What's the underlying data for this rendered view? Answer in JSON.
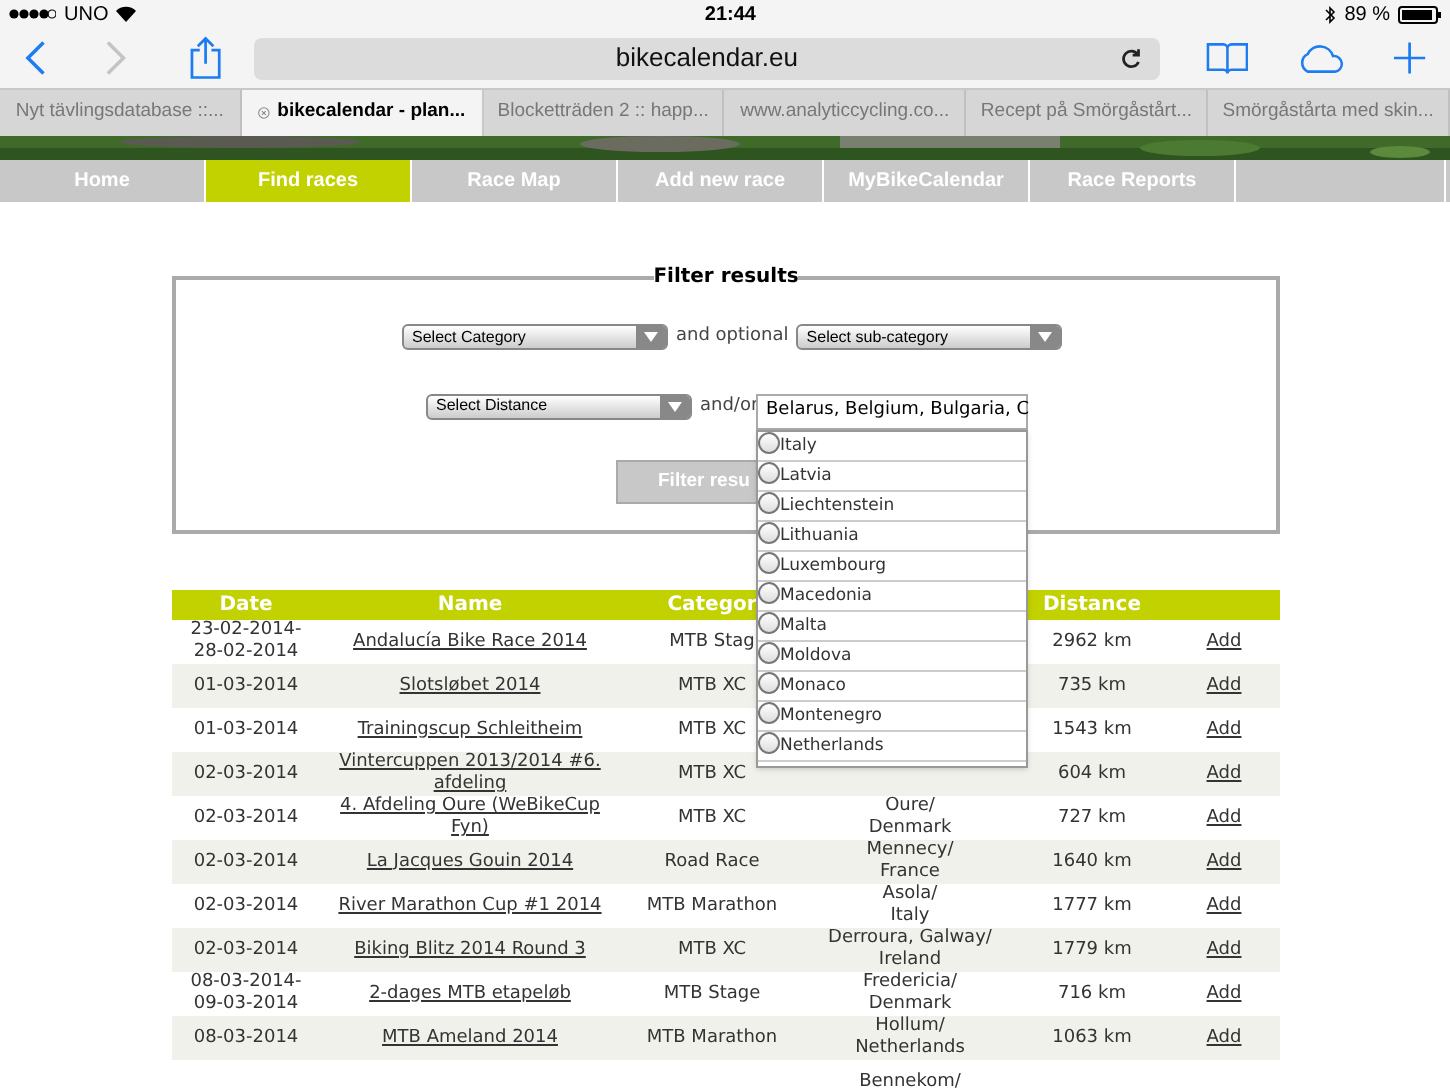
{
  "status_bar": {
    "carrier": "UNO",
    "time": "21:44",
    "battery": "89 %"
  },
  "browser": {
    "url": "bikecalendar.eu",
    "tabs": [
      {
        "label": "Nyt tävlingsdatabase ::...",
        "selected": false
      },
      {
        "label": "bikecalendar - plan...",
        "selected": true
      },
      {
        "label": "Blocketträden 2 :: happ...",
        "selected": false
      },
      {
        "label": "www.analyticcycling.co...",
        "selected": false
      },
      {
        "label": "Recept på Smörgåstårt...",
        "selected": false
      },
      {
        "label": "Smörgåstårta med skin...",
        "selected": false
      }
    ]
  },
  "nav": [
    {
      "label": "Home",
      "selected": false
    },
    {
      "label": "Find races",
      "selected": true
    },
    {
      "label": "Race Map",
      "selected": false
    },
    {
      "label": "Add new race",
      "selected": false
    },
    {
      "label": "MyBikeCalendar",
      "selected": false
    },
    {
      "label": "Race Reports",
      "selected": false
    }
  ],
  "filter": {
    "title": "Filter results",
    "category": "Select Category",
    "and_optional": "and optional",
    "subcategory": "Select sub-category",
    "distance": "Select Distance",
    "and_or": "and/or",
    "countries": "Belarus, Belgium, Bulgaria, C",
    "button": "Filter resu",
    "options": [
      {
        "label": "Italy",
        "checked": false
      },
      {
        "label": "Latvia",
        "checked": false
      },
      {
        "label": "Liechtenstein",
        "checked": false
      },
      {
        "label": "Lithuania",
        "checked": false
      },
      {
        "label": "Luxembourg",
        "checked": false
      },
      {
        "label": "Macedonia",
        "checked": false
      },
      {
        "label": "Malta",
        "checked": false
      },
      {
        "label": "Moldova",
        "checked": false
      },
      {
        "label": "Monaco",
        "checked": false
      },
      {
        "label": "Montenegro",
        "checked": false
      },
      {
        "label": "Netherlands",
        "checked": false
      }
    ]
  },
  "table": {
    "columns": {
      "date": "Date",
      "name": "Name",
      "category": "Categor",
      "distance": "Distance"
    },
    "rows": [
      {
        "date": "23-02-2014-\n28-02-2014",
        "name": "Andalucía Bike Race 2014",
        "category": "MTB Stag",
        "distance": "2962 km",
        "action": "Add"
      },
      {
        "date": "01-03-2014",
        "name": "Slotsløbet 2014",
        "category": "MTB XC",
        "distance": "735 km",
        "action": "Add"
      },
      {
        "date": "01-03-2014",
        "name": "Trainingscup Schleitheim",
        "category": "MTB XC",
        "distance": "1543 km",
        "action": "Add"
      },
      {
        "date": "02-03-2014",
        "name": "Vintercuppen 2013/2014 #6. afdeling",
        "category": "MTB XC",
        "distance": "604 km",
        "action": "Add"
      },
      {
        "date": "02-03-2014",
        "name": "4. Afdeling Oure (WeBikeCup Fyn)",
        "category": "MTB XC",
        "location": "Oure/\nDenmark",
        "distance": "727 km",
        "action": "Add"
      },
      {
        "date": "02-03-2014",
        "name": "La Jacques Gouin 2014",
        "category": "Road Race",
        "location": "Mennecy/\nFrance",
        "distance": "1640 km",
        "action": "Add"
      },
      {
        "date": "02-03-2014",
        "name": "River Marathon Cup #1 2014",
        "category": "MTB Marathon",
        "location": "Asola/\nItaly",
        "distance": "1777 km",
        "action": "Add"
      },
      {
        "date": "02-03-2014",
        "name": "Biking Blitz 2014 Round 3",
        "category": "MTB XC",
        "location": "Derroura, Galway/\nIreland",
        "distance": "1779 km",
        "action": "Add"
      },
      {
        "date": "08-03-2014-\n09-03-2014",
        "name": "2-dages MTB etapeløb",
        "category": "MTB Stage",
        "location": "Fredericia/\nDenmark",
        "distance": "716 km",
        "action": "Add"
      },
      {
        "date": "08-03-2014",
        "name": "MTB Ameland 2014",
        "category": "MTB Marathon",
        "location": "Hollum/\nNetherlands",
        "distance": "1063 km",
        "action": "Add"
      },
      {
        "location": "Bennekom/"
      }
    ]
  }
}
